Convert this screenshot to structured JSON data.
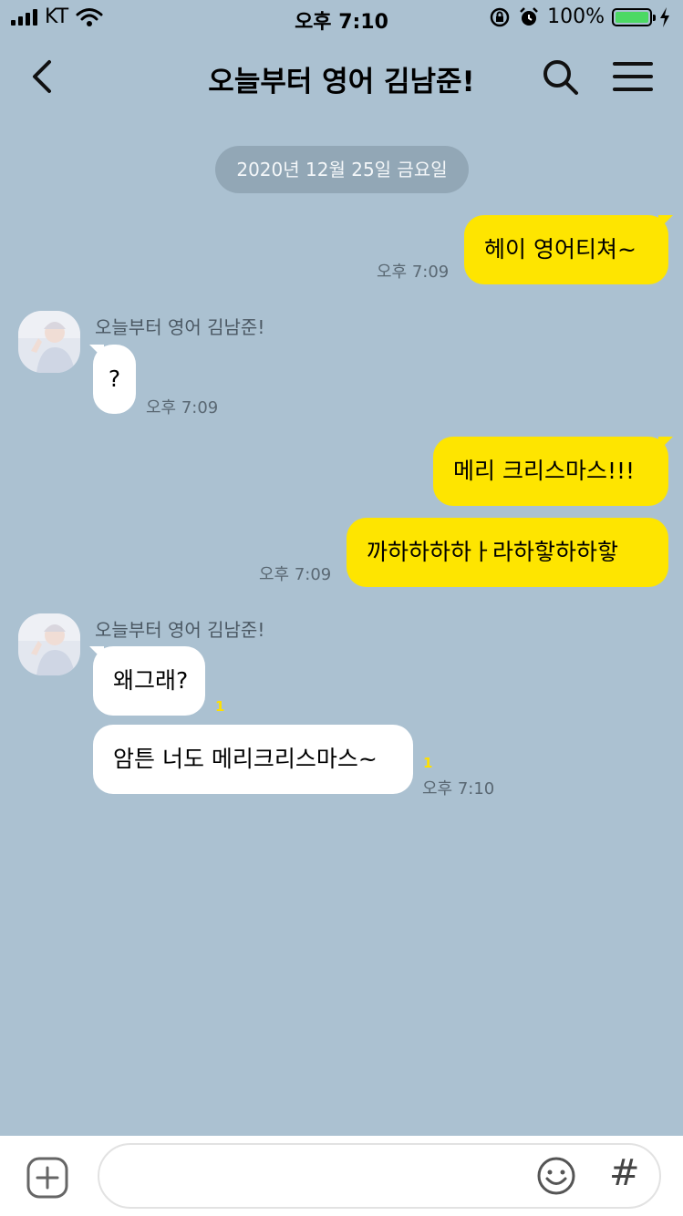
{
  "status_bar": {
    "carrier": "KT",
    "time": "오후 7:10",
    "battery_pct": "100%"
  },
  "header": {
    "title": "오늘부터 영어 김남준!",
    "icons": [
      "back-chevron-icon",
      "search-icon",
      "menu-icon"
    ]
  },
  "date_divider": "2020년 12월 25일 금요일",
  "messages": [
    {
      "from": "me",
      "text": "헤이 영어티쳐~",
      "time": "오후 7:09"
    },
    {
      "from": "them",
      "sender": "오늘부터 영어 김남준!",
      "text": "?",
      "time": "오후 7:09"
    },
    {
      "from": "me",
      "text": "메리 크리스마스!!!",
      "time": ""
    },
    {
      "from": "me",
      "text": "까하하하하ㅏ라하핳하하핳",
      "time": "오후 7:09"
    },
    {
      "from": "them",
      "sender": "오늘부터 영어 김남준!",
      "text": "왜그래?",
      "unread": "1"
    },
    {
      "from": "them",
      "text": "암튼 너도 메리크리스마스~",
      "unread": "1",
      "time": "오후 7:10"
    }
  ],
  "input_bar": {
    "placeholder": "",
    "hash_symbol": "#",
    "icons": [
      "plus-icon",
      "emoji-icon",
      "hash-icon"
    ]
  },
  "colors": {
    "background": "#abc1d1",
    "my_bubble": "#fee500",
    "their_bubble": "#ffffff",
    "unread": "#ffe000"
  }
}
